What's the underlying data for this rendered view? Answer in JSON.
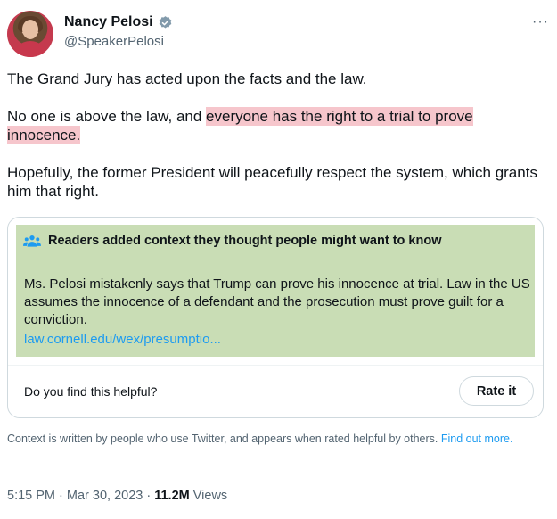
{
  "author": {
    "name": "Nancy Pelosi",
    "handle": "@SpeakerPelosi",
    "more_label": "···"
  },
  "tweet": {
    "line1": "The Grand Jury has acted upon the facts and the law.",
    "line2_plain": "No one is above the law, and ",
    "line2_highlight": "everyone has the right to a trial to prove innocence.",
    "line3": "Hopefully, the former President will peacefully respect the system, which grants him that right."
  },
  "note": {
    "title": "Readers added context they thought people might want to know",
    "body": "Ms. Pelosi mistakenly says that Trump can prove his innocence at trial. Law in the US assumes the innocence of a defendant and the prosecution must prove guilt for a conviction.",
    "link": "law.cornell.edu/wex/presumptio...",
    "helpful_question": "Do you find this helpful?",
    "rate_label": "Rate it"
  },
  "context": {
    "text": "Context is written by people who use Twitter, and appears when rated helpful by others. ",
    "link": "Find out more."
  },
  "meta": {
    "time_date": "5:15 PM · Mar 30, 2023 · ",
    "views_count": "11.2M",
    "views_label": " Views"
  },
  "colors": {
    "highlight": "#f6c6cc",
    "note_background": "#c9ddb5",
    "link": "#1d9bf0",
    "verified": "#829aab"
  },
  "icons": {
    "verified": "verified-badge-icon",
    "note": "people-icon",
    "more": "more-icon"
  }
}
